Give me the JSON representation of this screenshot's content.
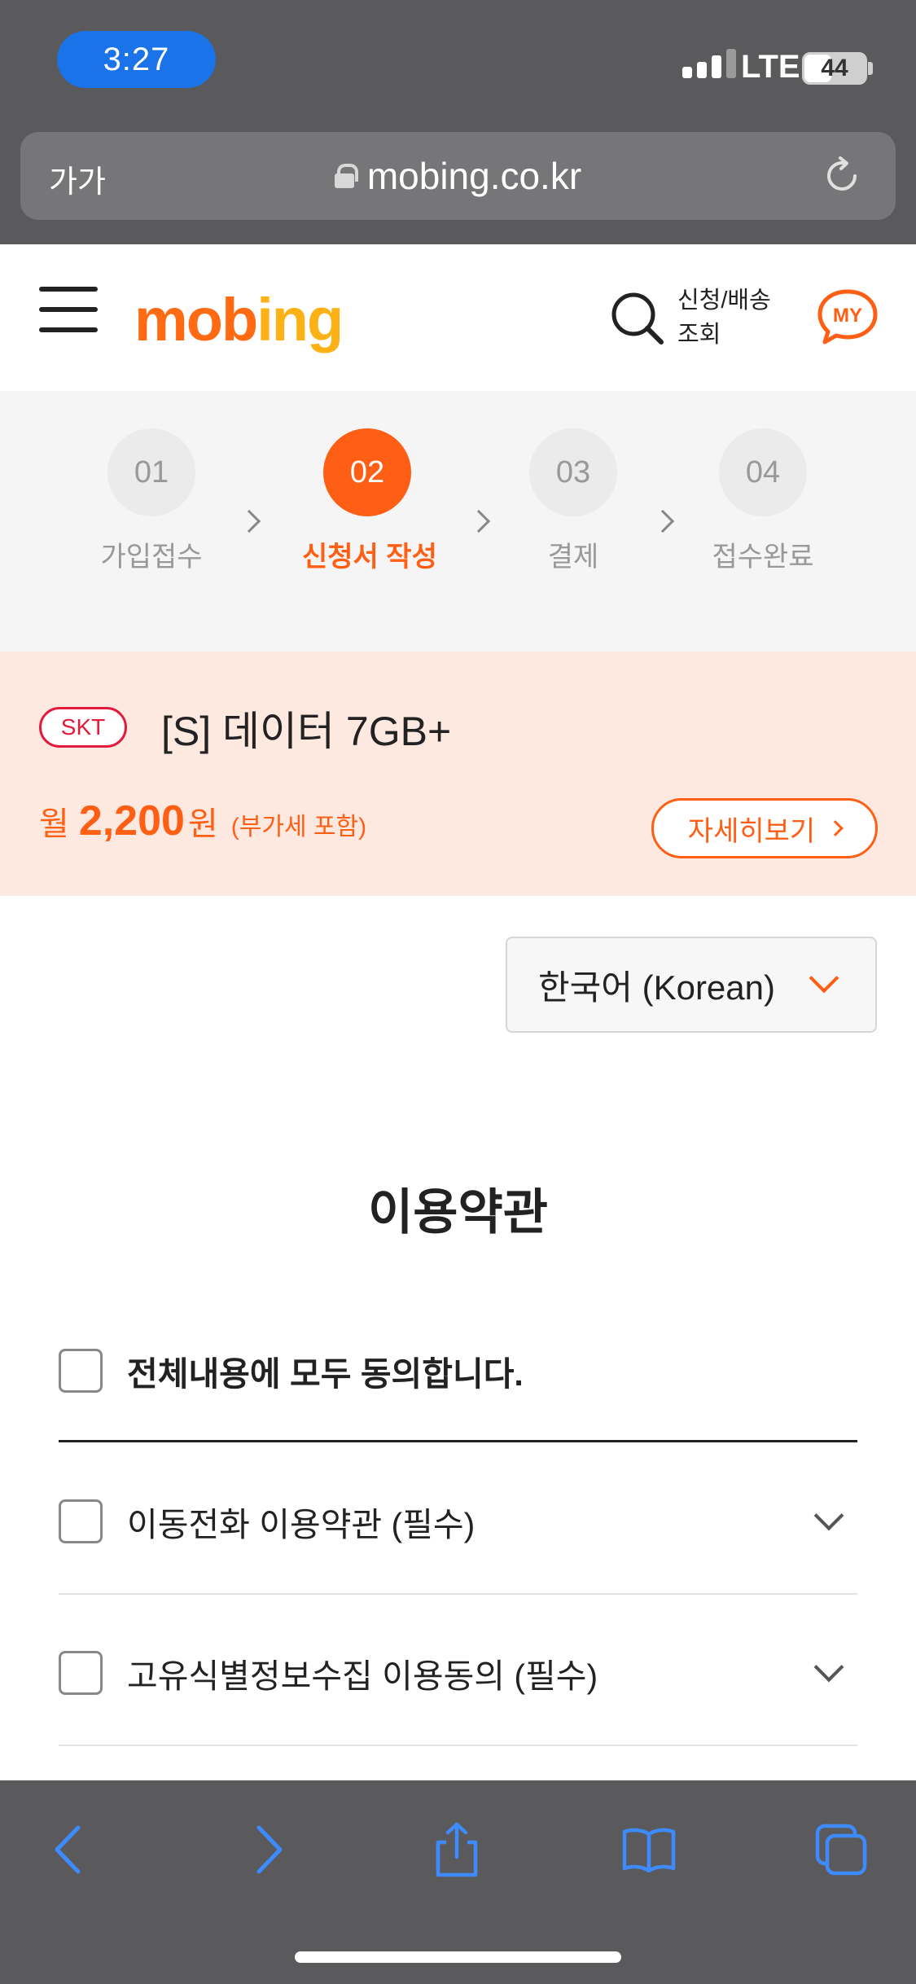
{
  "status_bar": {
    "time": "3:27",
    "network": "LTE",
    "battery": "44",
    "battery_level": 0.44
  },
  "browser": {
    "text_size_button": "가가",
    "url": "mobing.co.kr"
  },
  "header": {
    "logo_main": "mob",
    "logo_accent": "ing",
    "track_label_line1": "신청/배송",
    "track_label_line2": "조회",
    "my_label": "MY"
  },
  "steps": [
    {
      "number": "01",
      "label": "가입접수",
      "active": false
    },
    {
      "number": "02",
      "label": "신청서 작성",
      "active": true
    },
    {
      "number": "03",
      "label": "결제",
      "active": false
    },
    {
      "number": "04",
      "label": "접수완료",
      "active": false
    }
  ],
  "plan": {
    "carrier": "SKT",
    "name": "[S] 데이터 7GB+",
    "price_prefix": "월",
    "price_amount": "2,200",
    "price_unit": "원",
    "price_note": "(부가세 포함)",
    "detail_button": "자세히보기"
  },
  "language": {
    "selected": "한국어 (Korean)"
  },
  "terms": {
    "title": "이용약관",
    "agree_all": "전체내용에 모두 동의합니다.",
    "items": [
      {
        "label": "이동전화 이용약관 (필수)"
      },
      {
        "label": "고유식별정보수집 이용동의 (필수)"
      }
    ]
  },
  "colors": {
    "brand_orange": "#ff5f15",
    "logo_yellow": "#fcb216",
    "skt_red": "#e21b3c",
    "banner_bg": "#fde9e0",
    "safari_blue": "#3d8bff"
  }
}
